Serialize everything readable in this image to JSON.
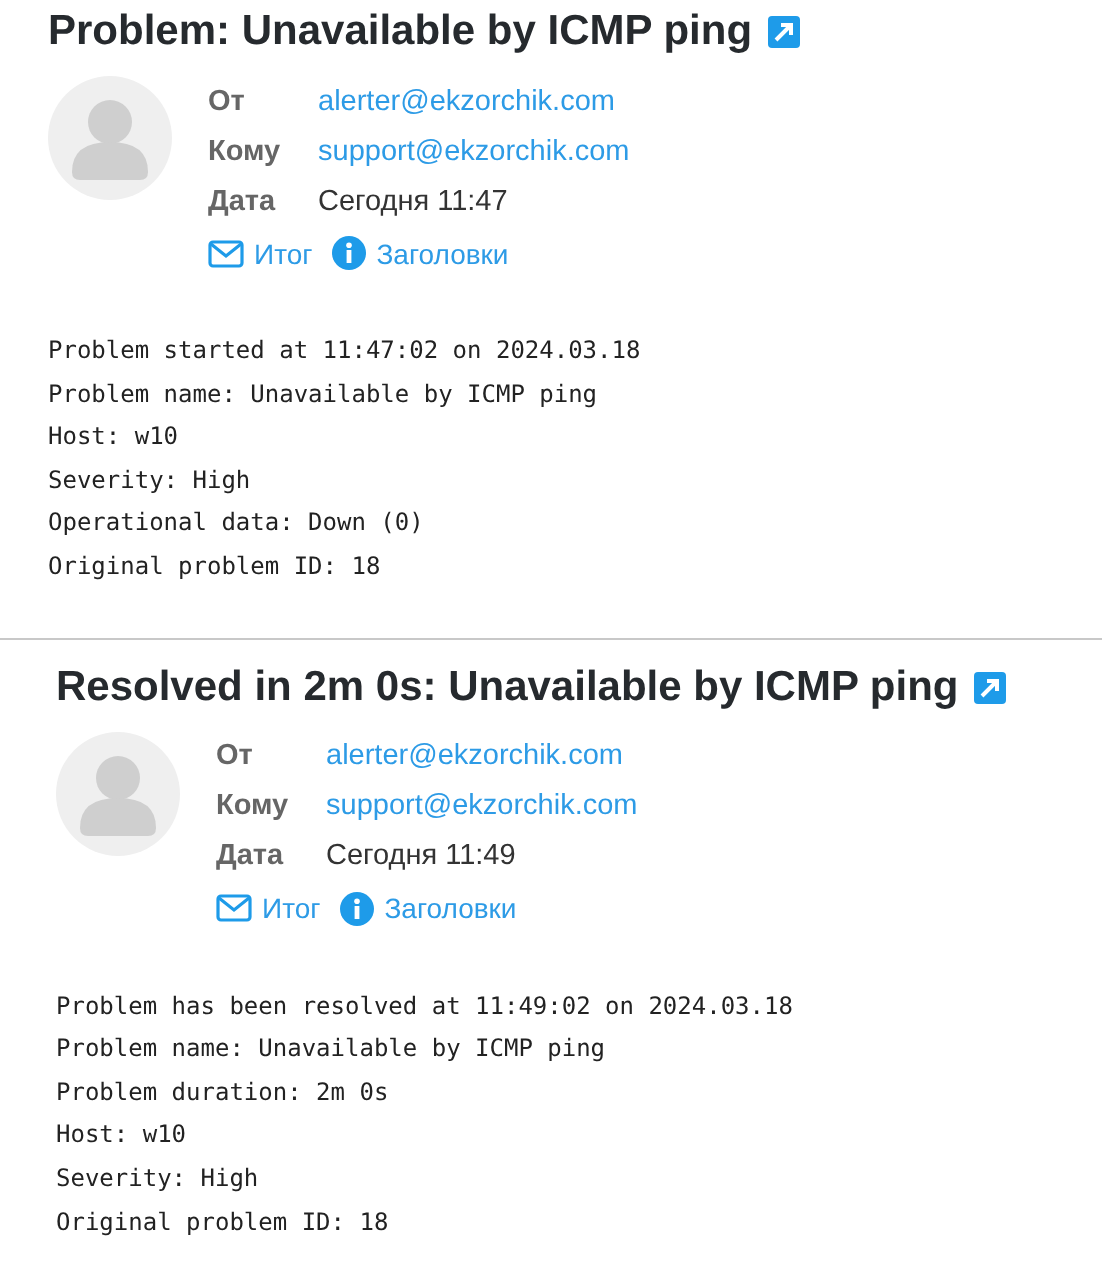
{
  "messages": [
    {
      "subject": "Problem: Unavailable by ICMP ping",
      "fields": [
        {
          "label": "От",
          "value": "alerter@ekzorchik.com",
          "kind": "link"
        },
        {
          "label": "Кому",
          "value": "support@ekzorchik.com",
          "kind": "link"
        },
        {
          "label": "Дата",
          "value": "Сегодня 11:47",
          "kind": "text"
        }
      ],
      "actions": [
        {
          "label": "Итог",
          "kind": "mail"
        },
        {
          "label": "Заголовки",
          "kind": "info"
        }
      ],
      "body": [
        "Problem started at 11:47:02 on 2024.03.18",
        "Problem name: Unavailable by ICMP ping",
        "Host: w10",
        "Severity: High",
        "Operational data: Down (0)",
        "Original problem ID: 18"
      ]
    },
    {
      "subject": "Resolved in 2m 0s: Unavailable by ICMP ping",
      "fields": [
        {
          "label": "От",
          "value": "alerter@ekzorchik.com",
          "kind": "link"
        },
        {
          "label": "Кому",
          "value": "support@ekzorchik.com",
          "kind": "link"
        },
        {
          "label": "Дата",
          "value": "Сегодня 11:49",
          "kind": "text"
        }
      ],
      "actions": [
        {
          "label": "Итог",
          "kind": "mail"
        },
        {
          "label": "Заголовки",
          "kind": "info"
        }
      ],
      "body": [
        "Problem has been resolved at 11:49:02 on 2024.03.18",
        "Problem name: Unavailable by ICMP ping",
        "Problem duration: 2m 0s",
        "Host: w10",
        "Severity: High",
        "Original problem ID: 18"
      ]
    }
  ]
}
